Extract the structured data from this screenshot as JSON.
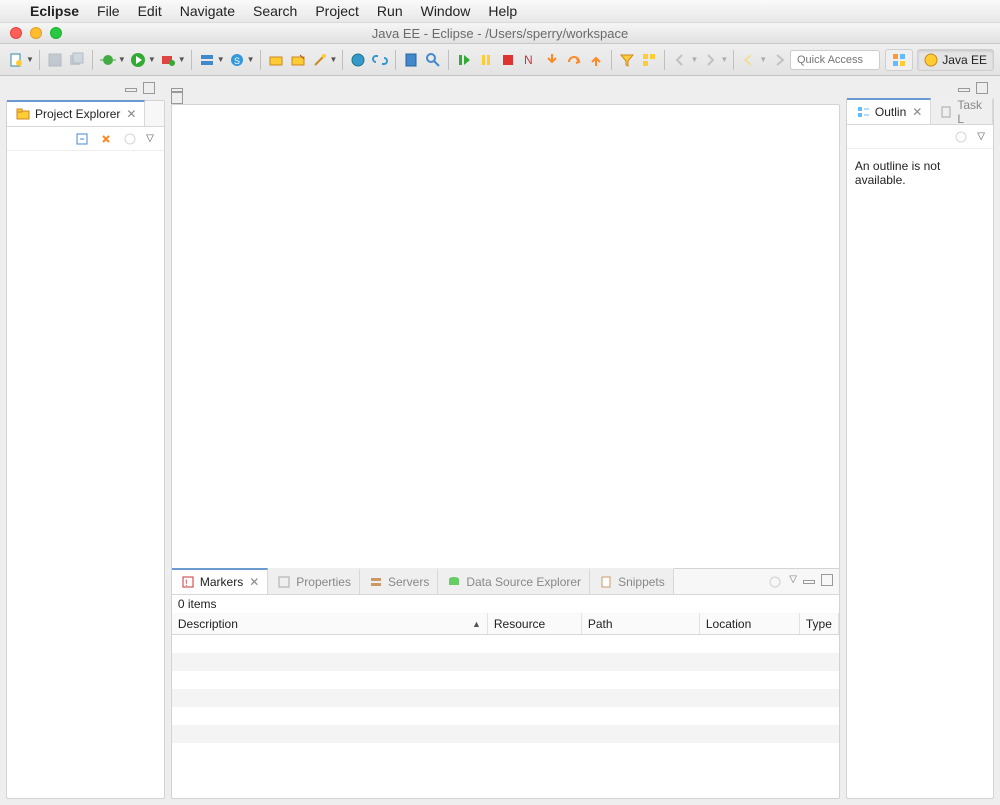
{
  "mac_menu": {
    "app": "Eclipse",
    "items": [
      "File",
      "Edit",
      "Navigate",
      "Search",
      "Project",
      "Run",
      "Window",
      "Help"
    ]
  },
  "window_title": "Java EE - Eclipse - /Users/sperry/workspace",
  "quick_access_placeholder": "Quick Access",
  "perspective": {
    "label": "Java EE"
  },
  "project_explorer": {
    "title": "Project Explorer"
  },
  "outline": {
    "tab1": "Outlin",
    "tab2": "Task L",
    "message": "An outline is not available."
  },
  "markers": {
    "tabs": [
      "Markers",
      "Properties",
      "Servers",
      "Data Source Explorer",
      "Snippets"
    ],
    "items_count": "0 items",
    "columns": [
      "Description",
      "Resource",
      "Path",
      "Location",
      "Type"
    ]
  }
}
